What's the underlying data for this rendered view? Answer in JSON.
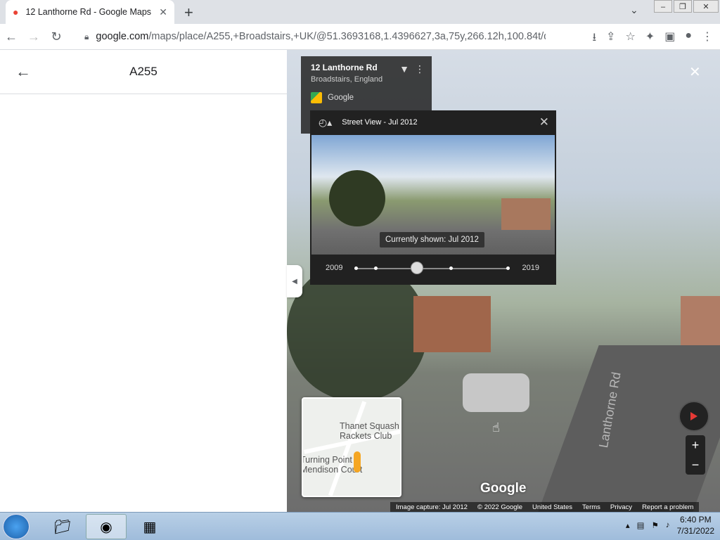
{
  "browser": {
    "tab_title": "12 Lanthorne Rd - Google Maps",
    "url_main": "google.com",
    "url_rest": "/maps/place/A255,+Broadstairs,+UK/@51.3693168,1.4396627,3a,75y,266.12h,100.84t/data..."
  },
  "side_panel": {
    "title": "A255"
  },
  "address_card": {
    "title": "12 Lanthorne Rd",
    "subtitle": "Broadstairs, England",
    "source": "Google"
  },
  "time_machine": {
    "header": "Street View - Jul 2012",
    "tooltip": "Currently shown: Jul 2012",
    "start_year": "2009",
    "end_year": "2019",
    "selected_position": 0.4
  },
  "mini_map": {
    "label_1a": "Thanet Squash",
    "label_1b": "Rackets Club",
    "label_2a": "Turning Point",
    "label_2b": "Mendison Court"
  },
  "map": {
    "watermark": "Google",
    "road_label": "Lanthorne Rd",
    "footer": [
      "Image capture: Jul 2012",
      "© 2022 Google",
      "United States",
      "Terms",
      "Privacy",
      "Report a problem"
    ]
  },
  "taskbar": {
    "time": "6:40 PM",
    "date": "7/31/2022"
  }
}
